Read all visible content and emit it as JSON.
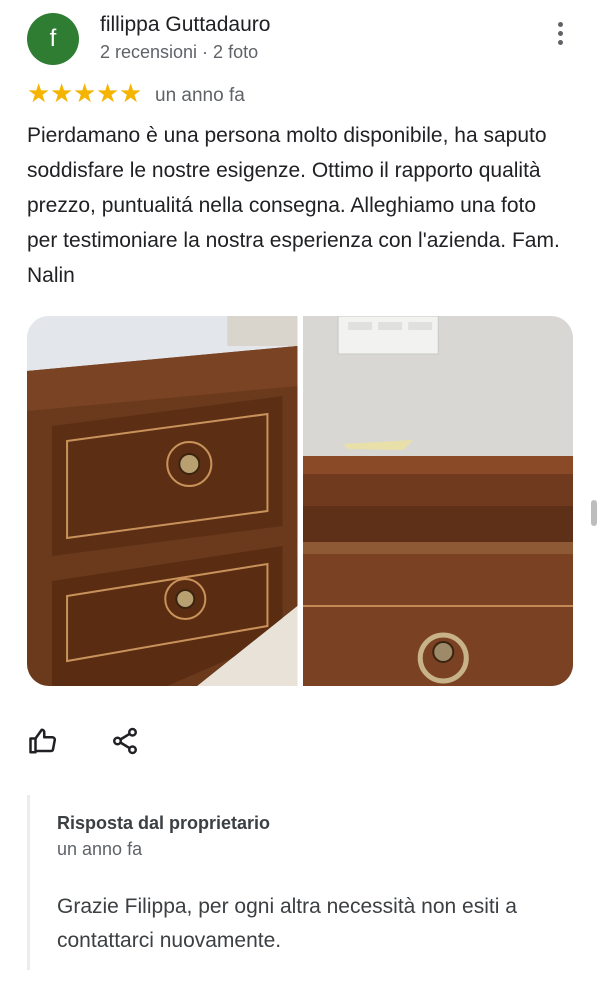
{
  "reviewer": {
    "avatar_letter": "f",
    "name": "fillippa Guttadauro",
    "meta": "2 recensioni · 2 foto"
  },
  "rating": {
    "stars": 5,
    "max": 5
  },
  "time": "un anno fa",
  "review_text": "Pierdamano è una persona molto disponibile, ha saputo soddisfare le nostre esigenze. Ottimo il rapporto qualità prezzo, puntualitá nella consegna. Alleghiamo una foto per testimoniare la nostra esperienza con l'azienda. Fam. Nalin",
  "photos": [
    {
      "subject": "wooden-dresser-drawers-photo"
    },
    {
      "subject": "wooden-dresser-drawer-closeup-photo"
    }
  ],
  "actions": [
    {
      "icon": "thumbs-up-icon"
    },
    {
      "icon": "share-icon"
    }
  ],
  "owner_reply": {
    "title": "Risposta dal proprietario",
    "time": "un anno fa",
    "text": "Grazie Filippa, per ogni altra necessità non esiti a contattarci nuovamente."
  },
  "colors": {
    "avatar": "#2e7d32",
    "star": "#f4b400",
    "secondary_text": "#5f6368"
  }
}
